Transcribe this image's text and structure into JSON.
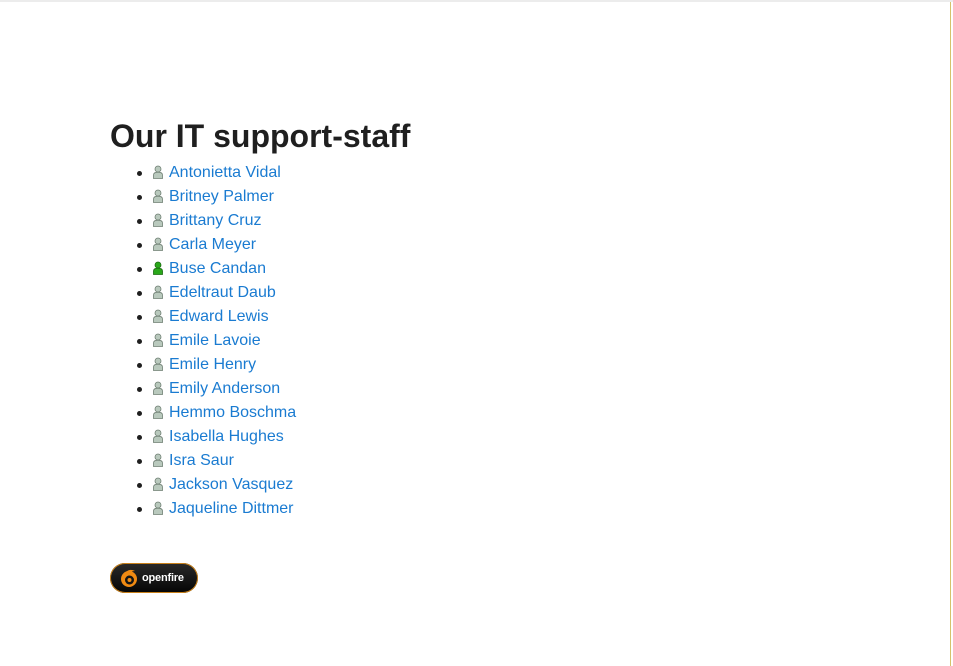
{
  "page": {
    "title": "Our IT support-staff"
  },
  "staff": [
    {
      "name": "Antonietta Vidal",
      "status": "offline"
    },
    {
      "name": "Britney Palmer",
      "status": "offline"
    },
    {
      "name": "Brittany Cruz",
      "status": "offline"
    },
    {
      "name": "Carla Meyer",
      "status": "offline"
    },
    {
      "name": "Buse Candan",
      "status": "online"
    },
    {
      "name": "Edeltraut Daub",
      "status": "offline"
    },
    {
      "name": "Edward Lewis",
      "status": "offline"
    },
    {
      "name": "Emile Lavoie",
      "status": "offline"
    },
    {
      "name": "Emile Henry",
      "status": "offline"
    },
    {
      "name": "Emily Anderson",
      "status": "offline"
    },
    {
      "name": "Hemmo Boschma",
      "status": "offline"
    },
    {
      "name": "Isabella Hughes",
      "status": "offline"
    },
    {
      "name": "Isra Saur",
      "status": "offline"
    },
    {
      "name": "Jackson Vasquez",
      "status": "offline"
    },
    {
      "name": "Jaqueline Dittmer",
      "status": "offline"
    }
  ],
  "badge": {
    "text": "openfire",
    "icon": "openfire-flame-icon"
  },
  "colors": {
    "link": "#1a7bd1",
    "heading": "#1f1f1f",
    "online": "#2aa81a",
    "offline": "#b9c9bd",
    "badge_accent": "#f08a12"
  }
}
